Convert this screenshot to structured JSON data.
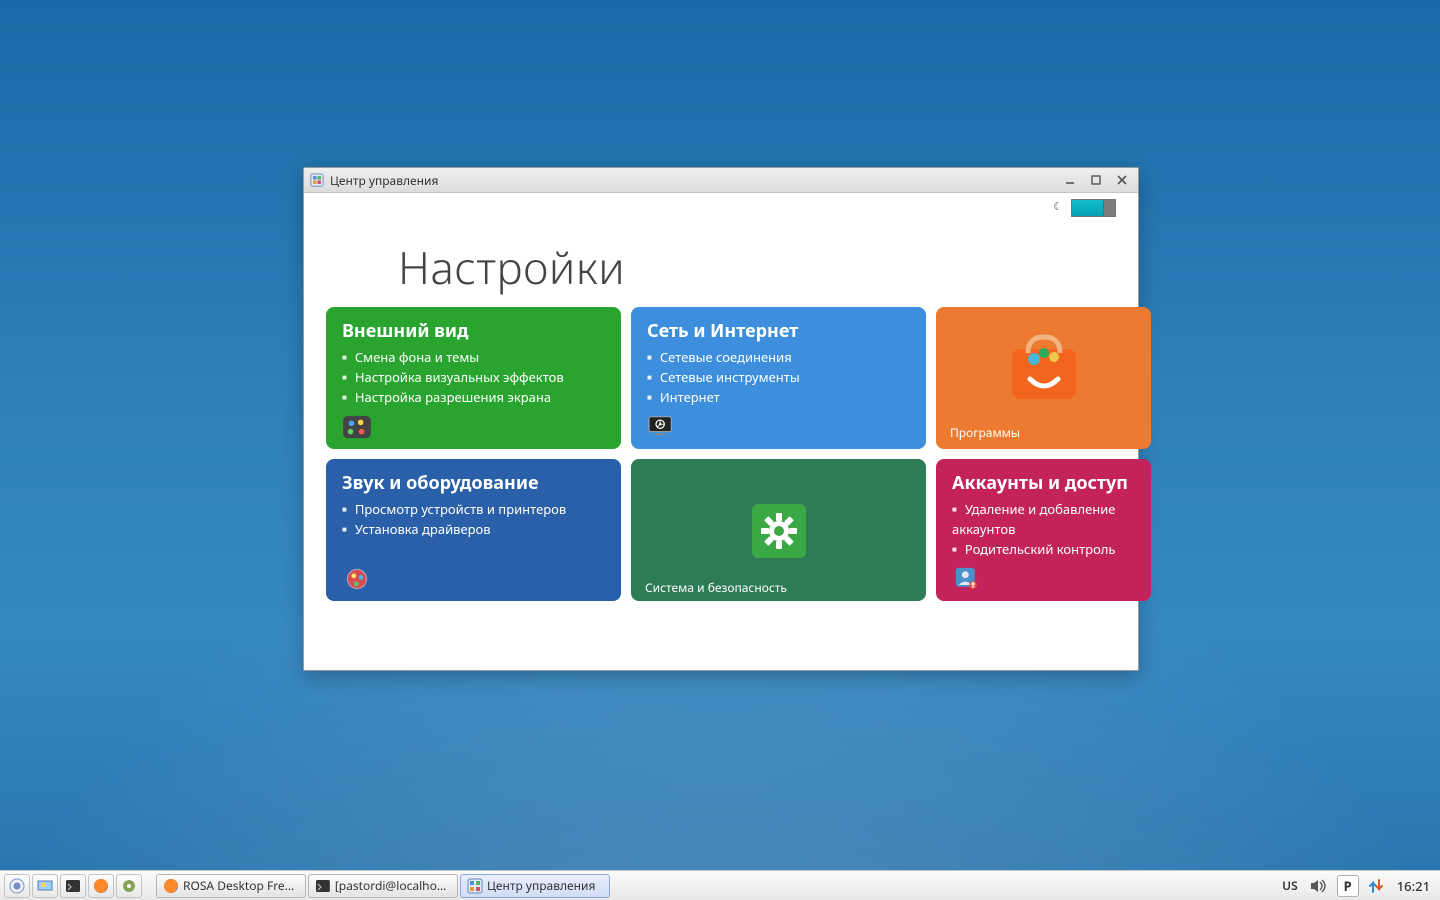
{
  "window": {
    "title": "Центр управления",
    "heading": "Настройки"
  },
  "tiles": {
    "appearance": {
      "title": "Внешний вид",
      "items": [
        "Смена фона и темы",
        "Настройка визуальных эффектов",
        "Настройка разрешения экрана"
      ]
    },
    "network": {
      "title": "Сеть и Интернет",
      "items": [
        "Сетевые соединения",
        "Сетевые инструменты",
        "Интернет"
      ]
    },
    "programs": {
      "caption": "Программы"
    },
    "sound": {
      "title": "Звук и оборудование",
      "items": [
        "Просмотр устройств и принтеров",
        "Установка драйверов"
      ]
    },
    "system": {
      "caption": "Система и безопасность"
    },
    "accounts": {
      "title": "Аккаунты и доступ",
      "items": [
        "Удаление и добавление аккаунтов",
        "Родительский контроль"
      ]
    }
  },
  "taskbar": {
    "tasks": [
      {
        "label": "ROSA Desktop Fre…"
      },
      {
        "label": "[pastordi@localhos…"
      },
      {
        "label": "Центр управления"
      }
    ],
    "lang": "US",
    "parking": "P",
    "clock": "16:21"
  }
}
